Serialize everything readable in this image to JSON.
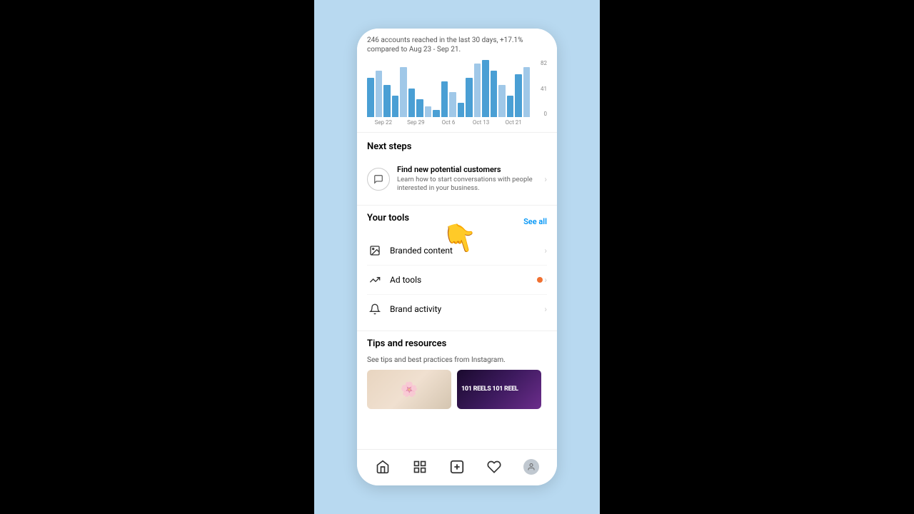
{
  "background": {
    "left_panel": "black",
    "right_panel": "black",
    "center": "light-blue"
  },
  "chart": {
    "subtitle": "246 accounts reached in the last 30 days, +17.1% compared to Aug 23 - Sep 21.",
    "y_labels": [
      "82",
      "41",
      "0"
    ],
    "x_labels": [
      "Sep 22",
      "Sep 29",
      "Oct 6",
      "Oct 13",
      "Oct 21"
    ],
    "bars": [
      55,
      65,
      45,
      30,
      70,
      40,
      25,
      15,
      10,
      50,
      35,
      20,
      55,
      75,
      80,
      65,
      45,
      30,
      60,
      70
    ]
  },
  "next_steps": {
    "section_title": "Next steps",
    "item": {
      "title": "Find new potential customers",
      "description": "Learn how to start conversations with people interested in your business."
    }
  },
  "your_tools": {
    "section_title": "Your tools",
    "see_all_label": "See all",
    "items": [
      {
        "label": "Branded content",
        "icon": "picture-icon"
      },
      {
        "label": "Ad tools",
        "icon": "trending-icon"
      },
      {
        "label": "Brand activity",
        "icon": "bell-icon"
      }
    ]
  },
  "tips": {
    "section_title": "Tips and resources",
    "description": "See tips and best practices from Instagram.",
    "cards": [
      {
        "type": "flowers",
        "alt": "Flower arrangement"
      },
      {
        "type": "reels",
        "label": "101 REELS 101 REEL"
      }
    ]
  },
  "bottom_nav": {
    "items": [
      {
        "name": "home",
        "icon": "🏠"
      },
      {
        "name": "search",
        "icon": "⊞"
      },
      {
        "name": "create",
        "icon": "+"
      },
      {
        "name": "heart",
        "icon": "♡"
      },
      {
        "name": "profile",
        "icon": "👤"
      }
    ]
  }
}
